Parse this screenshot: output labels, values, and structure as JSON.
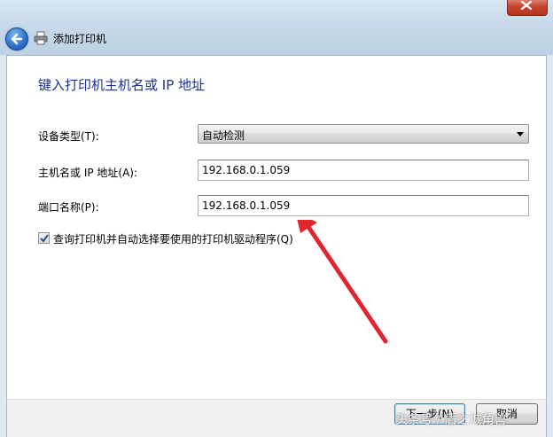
{
  "window": {
    "title": "添加打印机"
  },
  "page": {
    "heading": "键入打印机主机名或 IP 地址"
  },
  "form": {
    "device_type_label": "设备类型(T):",
    "device_type_value": "自动检测",
    "host_label": "主机名或 IP 地址(A):",
    "host_value": "192.168.0.1.059",
    "port_label": "端口名称(P):",
    "port_value": "192.168.0.1.059",
    "query_checkbox_label": "查询打印机并自动选择要使用的打印机驱动程序(Q)",
    "query_checkbox_checked": true
  },
  "footer": {
    "next_label": "下一步(N)",
    "cancel_label": "取消"
  },
  "watermark": "头条号 / 盾之城角兽",
  "colors": {
    "heading": "#1e3287",
    "annotation_arrow": "#e0262e",
    "close_button": "#c8452f"
  }
}
